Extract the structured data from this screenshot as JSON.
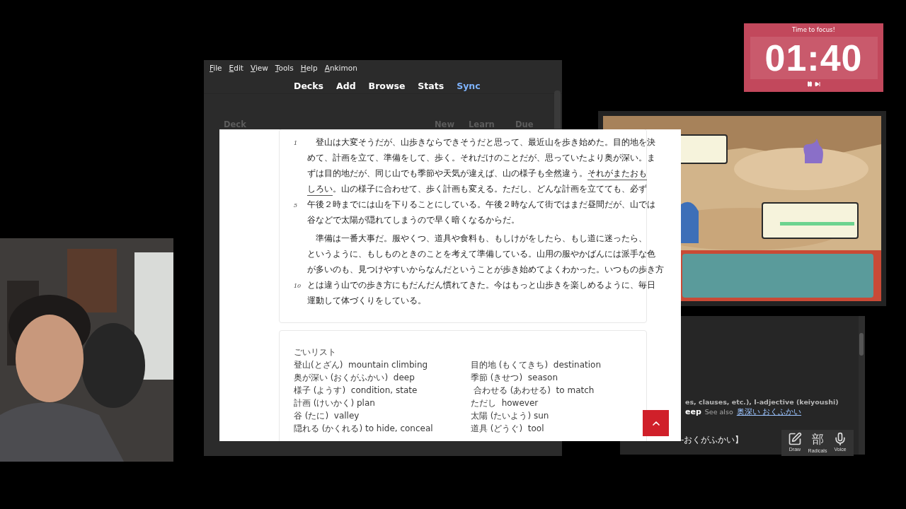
{
  "anki": {
    "menu": [
      {
        "label": "File"
      },
      {
        "label": "Edit"
      },
      {
        "label": "View"
      },
      {
        "label": "Tools"
      },
      {
        "label": "Help"
      },
      {
        "label": "Ankimon"
      }
    ],
    "toolbar": [
      {
        "label": "Decks",
        "highlighted": false
      },
      {
        "label": "Add",
        "highlighted": false
      },
      {
        "label": "Browse",
        "highlighted": false
      },
      {
        "label": "Stats",
        "highlighted": false
      },
      {
        "label": "Sync",
        "highlighted": true
      }
    ],
    "deck_header": [
      "Deck",
      "New",
      "Learn",
      "Due"
    ]
  },
  "document": {
    "reading": {
      "lines": [
        {
          "number": "1",
          "paragraph_start": true,
          "segments": [
            {
              "text": "登山は大変そうだが、山歩きならできそうだと思って、最近山を歩き始めた。目的地を決",
              "underlined": false
            }
          ]
        },
        {
          "segments": [
            {
              "text": "めて、計画を立て、準備をして、歩く。それだけのことだが、思っていたより奥が深い。ま",
              "underlined": false
            }
          ]
        },
        {
          "segments": [
            {
              "text": "ずは目的地だが、同じ山でも季節や天気が違えば、山の様子も全然違う。",
              "underlined": false
            },
            {
              "text": "それがまたおも",
              "underlined": true
            }
          ]
        },
        {
          "segments": [
            {
              "text": "しろい",
              "underlined": true
            },
            {
              "text": "。山の様子に合わせて、歩く計画も変える。ただし、どんな計画を立てても、必ず",
              "underlined": false
            }
          ]
        },
        {
          "number": "5",
          "segments": [
            {
              "text": "午後２時までには山を下りることにしている。午後２時なんて街ではまだ昼間だが、山では",
              "underlined": false
            }
          ]
        },
        {
          "segments": [
            {
              "text": "谷などで太陽が隠れてしまうので早く暗くなるからだ。",
              "underlined": false
            }
          ]
        },
        {
          "paragraph_start": true,
          "segments": [
            {
              "text": "準備は一番大事だ。服やくつ、道具や食料も、もしけがをしたら、もし道に迷ったら、",
              "underlined": false
            }
          ]
        },
        {
          "segments": [
            {
              "text": "というように、もしものときのことを考えて準備している。山用の服やかばんには派手な色",
              "underlined": false
            }
          ]
        },
        {
          "segments": [
            {
              "text": "が多いのも、見つけやすいからなんだということが歩き始めてよくわかった。いつもの歩き方",
              "underlined": false
            }
          ]
        },
        {
          "number": "10",
          "segments": [
            {
              "text": "とは違う山での歩き方にもだんだん慣れてきた。今はもっと山歩きを楽しめるように、毎日",
              "underlined": false
            }
          ]
        },
        {
          "segments": [
            {
              "text": "運動して体づくりをしている。",
              "underlined": false
            }
          ]
        }
      ]
    },
    "vocab": {
      "title": "ごいリスト",
      "rows": [
        {
          "left": "登山(とざん)  mountain climbing",
          "right": "目的地 (もくてきち)  destination"
        },
        {
          "left": "奥が深い (おくがふかい)  deep",
          "right": "季節 (きせつ)  season"
        },
        {
          "left": "様子 (ようす)  condition, state",
          "right": " 合わせる (あわせる)  to match"
        },
        {
          "left": "計画 (けいかく) plan",
          "right": "ただし  however"
        },
        {
          "left": "谷 (たに)  valley",
          "right": "太陽 (たいよう) sun"
        },
        {
          "left": "隠れる (かくれる) to hide, conceal",
          "right": "道具 (どうぐ)  tool"
        }
      ]
    }
  },
  "timer": {
    "label": "Time to focus!",
    "time": "01:40"
  },
  "dictionary": {
    "meta": "es, clauses, etc.), I-adjective (keiyoushi)",
    "gloss": "eep",
    "see_also_label": "See also",
    "see_also_link": "奥深い おくふかい",
    "reading": "-おくがふかい】",
    "tools": [
      {
        "kind": "draw",
        "label": "Draw"
      },
      {
        "kind": "radicals",
        "label": "Radicals",
        "glyph": "部"
      },
      {
        "kind": "voice",
        "label": "Voice"
      }
    ]
  }
}
